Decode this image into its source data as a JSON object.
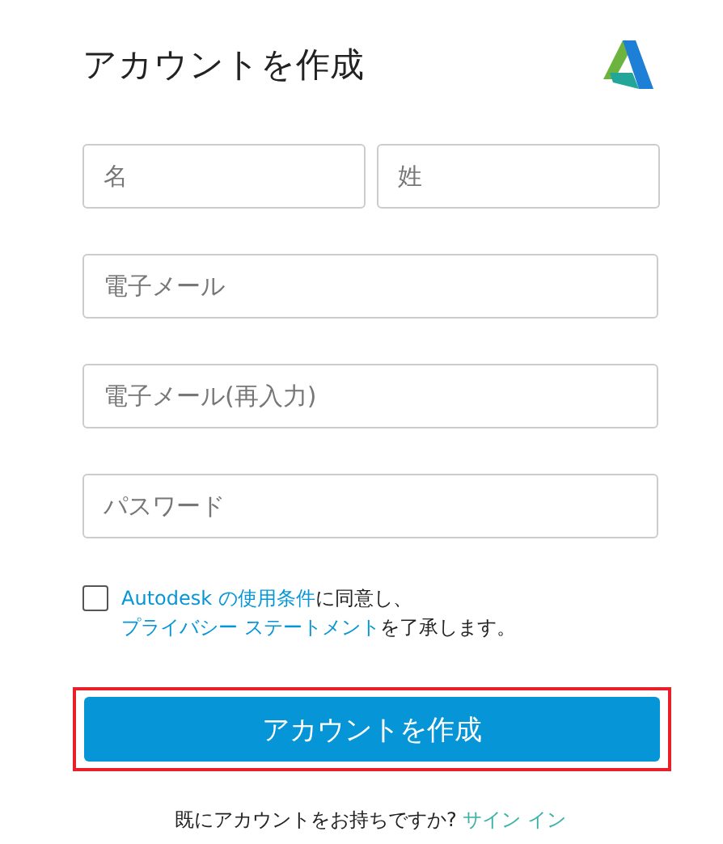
{
  "title": "アカウントを作成",
  "name_fields": [
    {
      "placeholder": "名"
    },
    {
      "placeholder": "姓"
    }
  ],
  "fields": [
    {
      "placeholder": "電子メール"
    },
    {
      "placeholder": "電子メール(再入力)"
    },
    {
      "placeholder": "パスワード"
    }
  ],
  "consent": {
    "checked": false,
    "parts": [
      {
        "kind": "link",
        "text": "Autodesk の使用条件"
      },
      {
        "kind": "text",
        "text": "に同意し、"
      },
      {
        "kind": "link",
        "text": "プライバシー ステートメント"
      },
      {
        "kind": "text",
        "text": "を了承します。"
      }
    ]
  },
  "submit_button": {
    "label": "アカウントを作成",
    "highlighted": true
  },
  "footer": {
    "text": "既にアカウントをお持ちですか?",
    "link": "サイン イン"
  }
}
